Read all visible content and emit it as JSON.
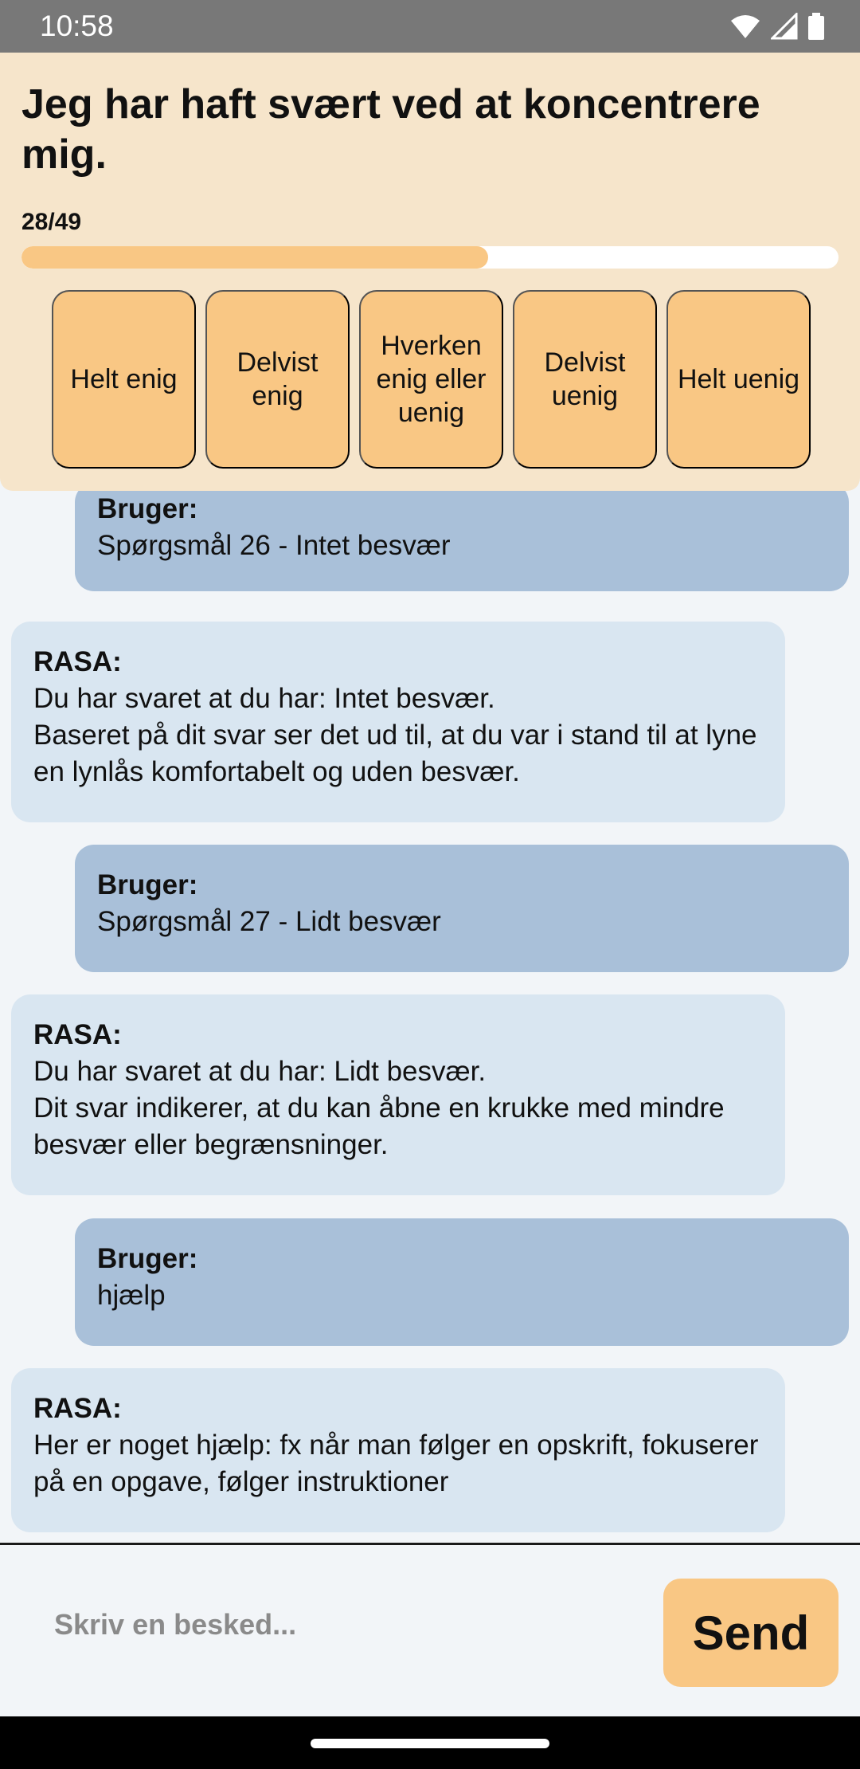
{
  "status_bar": {
    "time": "10:58"
  },
  "question": {
    "title": "Jeg har haft svært ved at koncentrere mig.",
    "progress_label": "28/49",
    "progress_current": 28,
    "progress_total": 49
  },
  "answers": [
    {
      "label": "Helt enig"
    },
    {
      "label": "Delvist enig"
    },
    {
      "label": "Hverken enig eller uenig"
    },
    {
      "label": "Delvist uenig"
    },
    {
      "label": "Helt uenig"
    }
  ],
  "chat": {
    "messages": [
      {
        "role": "user",
        "sender": "Bruger:",
        "text": "Spørgsmål 26 - Intet besvær"
      },
      {
        "role": "bot",
        "sender": "RASA:",
        "text": "Du har svaret at du har: Intet besvær.\nBaseret på dit svar ser det ud til, at du var i stand til at lyne en lynlås komfortabelt og uden besvær."
      },
      {
        "role": "user",
        "sender": "Bruger:",
        "text": "Spørgsmål 27 - Lidt besvær"
      },
      {
        "role": "bot",
        "sender": "RASA:",
        "text": "Du har svaret at du har: Lidt besvær.\nDit svar indikerer, at du kan åbne en krukke med mindre besvær eller begrænsninger."
      },
      {
        "role": "user",
        "sender": "Bruger:",
        "text": "hjælp"
      },
      {
        "role": "bot",
        "sender": "RASA:",
        "text": "Her er noget hjælp: fx når man følger en opskrift, fokuserer på en opgave, følger instruktioner"
      }
    ]
  },
  "composer": {
    "placeholder": "Skriv en besked...",
    "send_label": "Send"
  },
  "colors": {
    "accent": "#f9c784",
    "panel": "#f6e5cb",
    "user_bubble": "#a9c0d9",
    "bot_bubble": "#d9e6f1"
  }
}
